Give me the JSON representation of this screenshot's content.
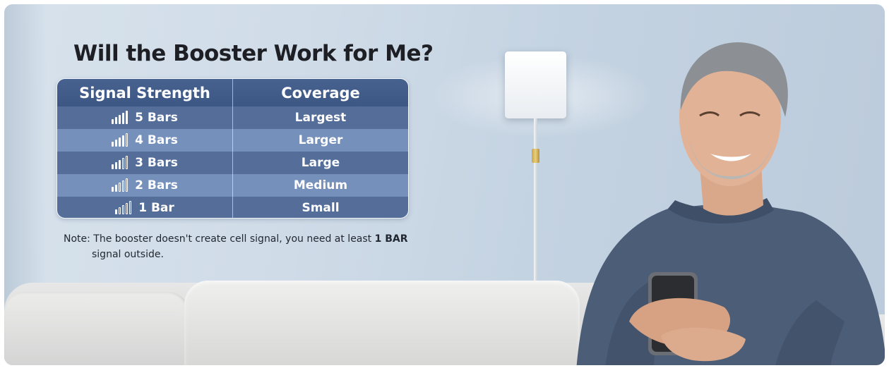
{
  "headline": "Will the Booster Work for Me?",
  "table": {
    "header": {
      "signal": "Signal Strength",
      "coverage": "Coverage"
    },
    "rows": [
      {
        "bars_label": "5 Bars",
        "coverage": "Largest",
        "bars_filled": 5
      },
      {
        "bars_label": "4 Bars",
        "coverage": "Larger",
        "bars_filled": 4
      },
      {
        "bars_label": "3 Bars",
        "coverage": "Large",
        "bars_filled": 3
      },
      {
        "bars_label": "2 Bars",
        "coverage": "Medium",
        "bars_filled": 2
      },
      {
        "bars_label": "1 Bar",
        "coverage": "Small",
        "bars_filled": 1
      }
    ]
  },
  "note": {
    "prefix": "Note: The booster doesn't create cell signal, you need at least ",
    "emphasis": "1 BAR",
    "line2": "signal outside."
  },
  "icons": {
    "signal": "signal-bars-icon",
    "antenna": "indoor-antenna-icon"
  },
  "colors": {
    "table_header": "#3d5785",
    "row_dark": "#546d99",
    "row_light": "#7590ba",
    "wall": "#cfdbe7"
  }
}
